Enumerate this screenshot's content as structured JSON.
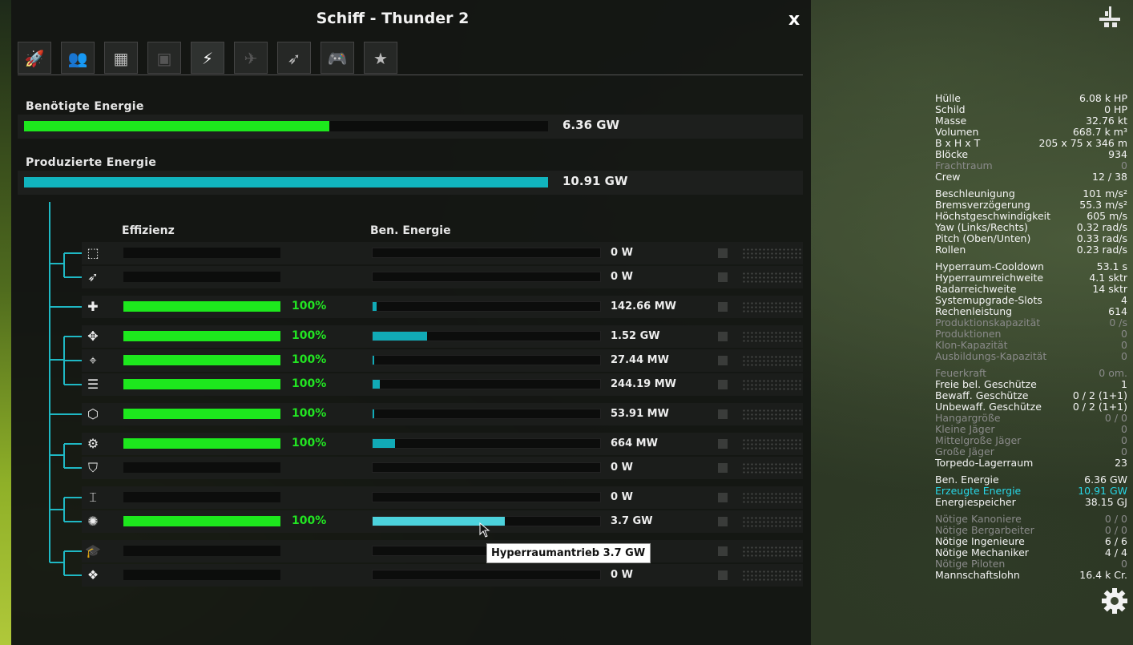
{
  "window": {
    "title": "Schiff - Thunder 2",
    "close_label": "x"
  },
  "tabs": [
    {
      "name": "tab-ship",
      "glyph": "🚀"
    },
    {
      "name": "tab-crew",
      "glyph": "👥"
    },
    {
      "name": "tab-blocks",
      "glyph": "▦"
    },
    {
      "name": "tab-cargo",
      "glyph": "▣"
    },
    {
      "name": "tab-energy",
      "glyph": "⚡",
      "active": true
    },
    {
      "name": "tab-fighters",
      "glyph": "✈"
    },
    {
      "name": "tab-torpedoes",
      "glyph": "➶"
    },
    {
      "name": "tab-controls",
      "glyph": "🎮"
    },
    {
      "name": "tab-favorites",
      "glyph": "★"
    }
  ],
  "required": {
    "label": "Benötigte Energie",
    "value": "6.36 GW",
    "fill_fraction": 0.583,
    "color": "#1de81d"
  },
  "produced": {
    "label": "Produzierte Energie",
    "value": "10.91 GW",
    "fill_fraction": 1.0,
    "color": "#11b4be"
  },
  "columns": {
    "efficiency": "Effizienz",
    "energy": "Ben. Energie"
  },
  "rows": [
    {
      "icon": "blocks-icon",
      "glyph": "⬚",
      "eff": 0,
      "pct": "",
      "energy_frac": 0,
      "energy": "0 W"
    },
    {
      "icon": "rocket-icon",
      "glyph": "➶",
      "eff": 0,
      "pct": "",
      "energy_frac": 0,
      "energy": "0 W"
    },
    {
      "icon": "plus-icon",
      "glyph": "✚",
      "eff": 1,
      "pct": "100%",
      "energy_frac": 0.018,
      "energy": "142.66 MW"
    },
    {
      "icon": "move-icon",
      "glyph": "✥",
      "eff": 1,
      "pct": "100%",
      "energy_frac": 0.24,
      "energy": "1.52 GW"
    },
    {
      "icon": "crosshair-icon",
      "glyph": "⌖",
      "eff": 1,
      "pct": "100%",
      "energy_frac": 0.006,
      "energy": "27.44 MW"
    },
    {
      "icon": "thrusters-icon",
      "glyph": "☰",
      "eff": 1,
      "pct": "100%",
      "energy_frac": 0.03,
      "energy": "244.19 MW"
    },
    {
      "icon": "cube-icon",
      "glyph": "⬡",
      "eff": 1,
      "pct": "100%",
      "energy_frac": 0.006,
      "energy": "53.91 MW"
    },
    {
      "icon": "engine-icon",
      "glyph": "⚙",
      "eff": 1,
      "pct": "100%",
      "energy_frac": 0.1,
      "energy": "664 MW"
    },
    {
      "icon": "shield-icon",
      "glyph": "⛉",
      "eff": 0,
      "pct": "",
      "energy_frac": 0,
      "energy": "0 W"
    },
    {
      "icon": "turret-icon",
      "glyph": "⌶",
      "eff": 0,
      "pct": "",
      "energy_frac": 0,
      "energy": "0 W"
    },
    {
      "icon": "hyperspace-icon",
      "glyph": "✺",
      "eff": 1,
      "pct": "100%",
      "energy_frac": 0.58,
      "energy": "3.7 GW",
      "highlight": true
    },
    {
      "icon": "academy-icon",
      "glyph": "🎓",
      "eff": 0,
      "pct": "",
      "energy_frac": 0,
      "energy": ""
    },
    {
      "icon": "crew-gear-icon",
      "glyph": "❖",
      "eff": 0,
      "pct": "",
      "energy_frac": 0,
      "energy": "0 W"
    }
  ],
  "tooltip": "Hyperraumantrieb 3.7 GW",
  "stats": [
    [
      {
        "k": "Hülle",
        "v": "6.08 k HP"
      },
      {
        "k": "Schild",
        "v": "0  HP"
      },
      {
        "k": "Masse",
        "v": "32.76 kt"
      },
      {
        "k": "Volumen",
        "v": "668.7 k m³"
      },
      {
        "k": "B x H x T",
        "v": "205 x 75 x 346 m"
      },
      {
        "k": "Blöcke",
        "v": "934"
      },
      {
        "k": "Frachtraum",
        "v": "0",
        "dim": true
      },
      {
        "k": "Crew",
        "v": "12 / 38"
      }
    ],
    [
      {
        "k": "Beschleunigung",
        "v": "101 m/s²"
      },
      {
        "k": "Bremsverzögerung",
        "v": "55.3 m/s²"
      },
      {
        "k": "Höchstgeschwindigkeit",
        "v": "605 m/s"
      },
      {
        "k": "Yaw (Links/Rechts)",
        "v": "0.32 rad/s"
      },
      {
        "k": "Pitch (Oben/Unten)",
        "v": "0.33 rad/s"
      },
      {
        "k": "Rollen",
        "v": "0.23 rad/s"
      }
    ],
    [
      {
        "k": "Hyperraum-Cooldown",
        "v": "53.1 s"
      },
      {
        "k": "Hyperraumreichweite",
        "v": "4.1 sktr"
      },
      {
        "k": "Radarreichweite",
        "v": "14 sktr"
      },
      {
        "k": "Systemupgrade-Slots",
        "v": "4"
      },
      {
        "k": "Rechenleistung",
        "v": "614"
      },
      {
        "k": "Produktionskapazität",
        "v": "0 /s",
        "dim": true
      },
      {
        "k": "Produktionen",
        "v": "0",
        "dim": true
      },
      {
        "k": "Klon-Kapazität",
        "v": "0",
        "dim": true
      },
      {
        "k": "Ausbildungs-Kapazität",
        "v": "0",
        "dim": true
      }
    ],
    [
      {
        "k": "Feuerkraft",
        "v": "0  om.",
        "dim": true
      },
      {
        "k": "Freie bel. Geschütze",
        "v": "1"
      },
      {
        "k": "Bewaff. Geschütze",
        "v": "0 / 2 (1+1)"
      },
      {
        "k": "Unbewaff. Geschütze",
        "v": "0 / 2 (1+1)"
      },
      {
        "k": "Hangargröße",
        "v": "0 / 0",
        "dim": true
      },
      {
        "k": "Kleine Jäger",
        "v": "0",
        "dim": true
      },
      {
        "k": "Mittelgroße Jäger",
        "v": "0",
        "dim": true
      },
      {
        "k": "Große Jäger",
        "v": "0",
        "dim": true
      },
      {
        "k": "Torpedo-Lagerraum",
        "v": "23"
      }
    ],
    [
      {
        "k": "Ben. Energie",
        "v": "6.36 GW"
      },
      {
        "k": "Erzeugte Energie",
        "v": "10.91 GW",
        "cyan": true
      },
      {
        "k": "Energiespeicher",
        "v": "38.15 GJ"
      }
    ],
    [
      {
        "k": "Nötige Kanoniere",
        "v": "0 / 0",
        "dim": true
      },
      {
        "k": "Nötige Bergarbeiter",
        "v": "0 / 0",
        "dim": true
      },
      {
        "k": "Nötige Ingenieure",
        "v": "6 / 6"
      },
      {
        "k": "Nötige Mechaniker",
        "v": "4 / 4"
      },
      {
        "k": "Nötige Piloten",
        "v": "0",
        "dim": true
      },
      {
        "k": "Mannschaftslohn",
        "v": "16.4 k Cr."
      }
    ]
  ]
}
